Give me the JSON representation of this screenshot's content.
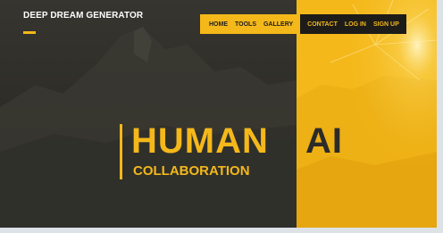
{
  "site": {
    "logo": "DEEP DREAM GENERATOR"
  },
  "nav": {
    "primary": [
      {
        "label": "HOME"
      },
      {
        "label": "TOOLS"
      },
      {
        "label": "GALLERY"
      }
    ],
    "secondary": [
      {
        "label": "CONTACT"
      },
      {
        "label": "LOG IN"
      },
      {
        "label": "SIGN UP"
      }
    ]
  },
  "hero": {
    "word1": "HUMAN",
    "word2": "AI",
    "subtitle": "COLLABORATION"
  },
  "colors": {
    "accent": "#f4b81a",
    "dark": "#2b2a26",
    "nav_dark": "#1d1c19"
  }
}
